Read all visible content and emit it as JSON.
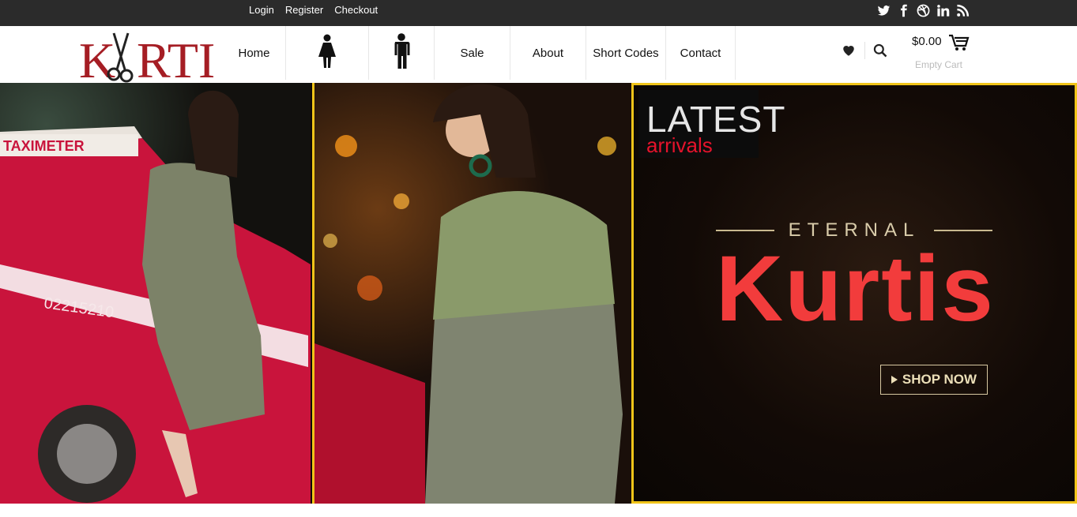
{
  "topbar": {
    "links": [
      "Login",
      "Register",
      "Checkout"
    ],
    "social_icons": [
      "twitter-icon",
      "facebook-icon",
      "dribbble-icon",
      "linkedin-icon",
      "rss-icon"
    ]
  },
  "header": {
    "logo_text": "KRTI",
    "nav": [
      {
        "label": "Home"
      },
      {
        "label": "",
        "icon": "woman-icon"
      },
      {
        "label": "",
        "icon": "man-icon"
      },
      {
        "label": "Sale"
      },
      {
        "label": "About"
      },
      {
        "label": "Short Codes"
      },
      {
        "label": "Contact"
      }
    ],
    "cart": {
      "price": "$0.00",
      "status": "Empty Cart"
    }
  },
  "banner": {
    "latest_label": "LATEST",
    "arrivals_label": "arrivals",
    "eternal_label": "ETERNAL",
    "headline": "Kurtis",
    "cta_label": "SHOP NOW",
    "photo1_sign": "TAXIMETER",
    "photo1_plate": "02215210",
    "colors": {
      "accent_border": "#f0c419",
      "headline_red": "#f23c3c",
      "arrivals_red": "#e5132b"
    }
  }
}
